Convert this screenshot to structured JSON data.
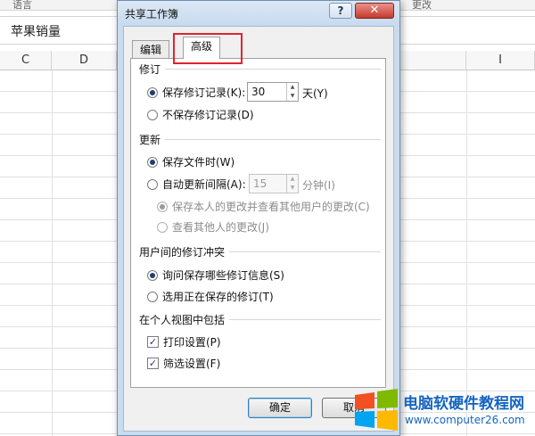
{
  "spreadsheet": {
    "ribbon_labels": [
      "语言",
      "更改"
    ],
    "formula_bar_value": "苹果销量",
    "columns": [
      "C",
      "D",
      "I"
    ]
  },
  "dialog": {
    "title": "共享工作簿",
    "help_glyph": "?",
    "close_glyph": "✕",
    "tabs": [
      {
        "label": "编辑",
        "active": false
      },
      {
        "label": "高级",
        "active": true
      }
    ],
    "track_changes": {
      "heading": "修订",
      "keep_history_label": "保存修订记录(K):",
      "keep_history_selected": true,
      "days_value": "30",
      "days_unit": "天(Y)",
      "no_history_label": "不保存修订记录(D)",
      "no_history_selected": false
    },
    "update": {
      "heading": "更新",
      "on_save_label": "保存文件时(W)",
      "on_save_selected": true,
      "auto_label": "自动更新间隔(A):",
      "auto_selected": false,
      "interval_value": "15",
      "interval_unit": "分钟(I)",
      "save_mine_label": "保存本人的更改并查看其他用户的更改(C)",
      "save_mine_selected": true,
      "see_others_label": "查看其他人的更改(J)",
      "see_others_selected": false
    },
    "conflicts": {
      "heading": "用户间的修订冲突",
      "ask_label": "询问保存哪些修订信息(S)",
      "ask_selected": true,
      "win_label": "选用正在保存的修订(T)",
      "win_selected": false
    },
    "personal_view": {
      "heading": "在个人视图中包括",
      "print_label": "打印设置(P)",
      "print_checked": true,
      "filter_label": "筛选设置(F)",
      "filter_checked": true
    },
    "buttons": {
      "ok": "确定",
      "cancel": "取消"
    },
    "check_glyph": "✓",
    "spin_up": "▲",
    "spin_down": "▼"
  },
  "watermark": {
    "name": "电脑软硬件教程网",
    "url": "www.computer26.com"
  },
  "colors": {
    "highlight_box": "#e0242c",
    "watermark_text": "#1765c0"
  }
}
